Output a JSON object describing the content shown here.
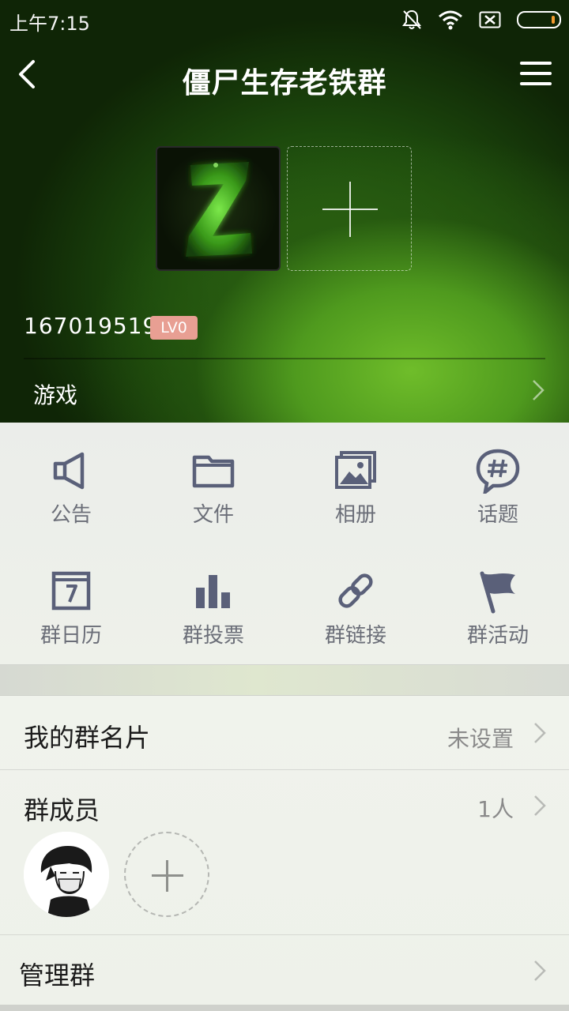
{
  "status_bar": {
    "time": "上午7:15"
  },
  "header": {
    "title": "僵尸生存老铁群",
    "group_id": "167019519",
    "level_badge": "LV0",
    "category": "游戏"
  },
  "functions": [
    {
      "label": "公告",
      "icon": "megaphone-icon"
    },
    {
      "label": "文件",
      "icon": "folder-icon"
    },
    {
      "label": "相册",
      "icon": "photo-album-icon"
    },
    {
      "label": "话题",
      "icon": "topic-hash-icon"
    },
    {
      "label": "群日历",
      "icon": "calendar-icon"
    },
    {
      "label": "群投票",
      "icon": "bar-chart-icon"
    },
    {
      "label": "群链接",
      "icon": "link-icon"
    },
    {
      "label": "群活动",
      "icon": "flag-icon"
    }
  ],
  "rows": {
    "card": {
      "label": "我的群名片",
      "value": "未设置"
    },
    "members": {
      "label": "群成员",
      "value": "1人"
    },
    "manage": {
      "label": "管理群"
    }
  },
  "colors": {
    "icon": "#5a6079",
    "badge": "#e89f93",
    "hero_green": "#6fbd2a"
  }
}
